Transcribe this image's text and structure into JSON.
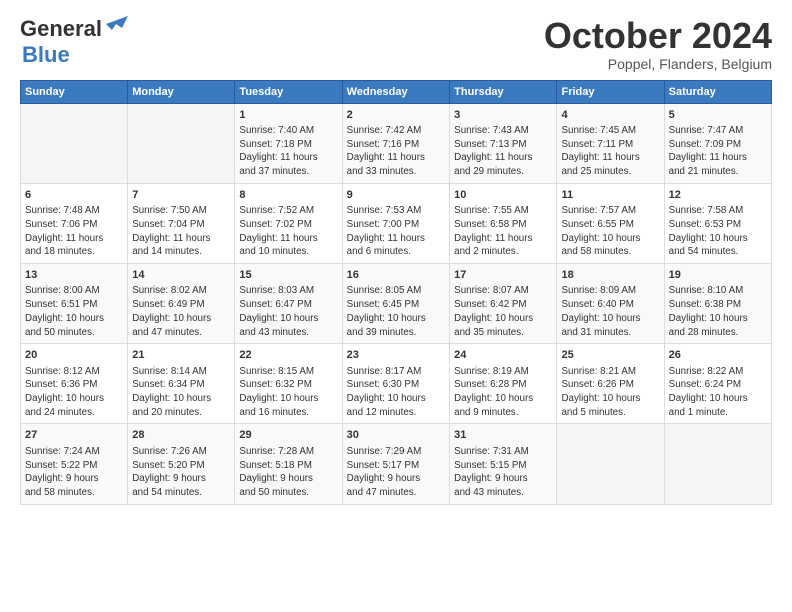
{
  "logo": {
    "line1": "General",
    "line2": "Blue"
  },
  "title": "October 2024",
  "location": "Poppel, Flanders, Belgium",
  "days_header": [
    "Sunday",
    "Monday",
    "Tuesday",
    "Wednesday",
    "Thursday",
    "Friday",
    "Saturday"
  ],
  "weeks": [
    [
      {
        "day": "",
        "info": ""
      },
      {
        "day": "",
        "info": ""
      },
      {
        "day": "1",
        "info": "Sunrise: 7:40 AM\nSunset: 7:18 PM\nDaylight: 11 hours\nand 37 minutes."
      },
      {
        "day": "2",
        "info": "Sunrise: 7:42 AM\nSunset: 7:16 PM\nDaylight: 11 hours\nand 33 minutes."
      },
      {
        "day": "3",
        "info": "Sunrise: 7:43 AM\nSunset: 7:13 PM\nDaylight: 11 hours\nand 29 minutes."
      },
      {
        "day": "4",
        "info": "Sunrise: 7:45 AM\nSunset: 7:11 PM\nDaylight: 11 hours\nand 25 minutes."
      },
      {
        "day": "5",
        "info": "Sunrise: 7:47 AM\nSunset: 7:09 PM\nDaylight: 11 hours\nand 21 minutes."
      }
    ],
    [
      {
        "day": "6",
        "info": "Sunrise: 7:48 AM\nSunset: 7:06 PM\nDaylight: 11 hours\nand 18 minutes."
      },
      {
        "day": "7",
        "info": "Sunrise: 7:50 AM\nSunset: 7:04 PM\nDaylight: 11 hours\nand 14 minutes."
      },
      {
        "day": "8",
        "info": "Sunrise: 7:52 AM\nSunset: 7:02 PM\nDaylight: 11 hours\nand 10 minutes."
      },
      {
        "day": "9",
        "info": "Sunrise: 7:53 AM\nSunset: 7:00 PM\nDaylight: 11 hours\nand 6 minutes."
      },
      {
        "day": "10",
        "info": "Sunrise: 7:55 AM\nSunset: 6:58 PM\nDaylight: 11 hours\nand 2 minutes."
      },
      {
        "day": "11",
        "info": "Sunrise: 7:57 AM\nSunset: 6:55 PM\nDaylight: 10 hours\nand 58 minutes."
      },
      {
        "day": "12",
        "info": "Sunrise: 7:58 AM\nSunset: 6:53 PM\nDaylight: 10 hours\nand 54 minutes."
      }
    ],
    [
      {
        "day": "13",
        "info": "Sunrise: 8:00 AM\nSunset: 6:51 PM\nDaylight: 10 hours\nand 50 minutes."
      },
      {
        "day": "14",
        "info": "Sunrise: 8:02 AM\nSunset: 6:49 PM\nDaylight: 10 hours\nand 47 minutes."
      },
      {
        "day": "15",
        "info": "Sunrise: 8:03 AM\nSunset: 6:47 PM\nDaylight: 10 hours\nand 43 minutes."
      },
      {
        "day": "16",
        "info": "Sunrise: 8:05 AM\nSunset: 6:45 PM\nDaylight: 10 hours\nand 39 minutes."
      },
      {
        "day": "17",
        "info": "Sunrise: 8:07 AM\nSunset: 6:42 PM\nDaylight: 10 hours\nand 35 minutes."
      },
      {
        "day": "18",
        "info": "Sunrise: 8:09 AM\nSunset: 6:40 PM\nDaylight: 10 hours\nand 31 minutes."
      },
      {
        "day": "19",
        "info": "Sunrise: 8:10 AM\nSunset: 6:38 PM\nDaylight: 10 hours\nand 28 minutes."
      }
    ],
    [
      {
        "day": "20",
        "info": "Sunrise: 8:12 AM\nSunset: 6:36 PM\nDaylight: 10 hours\nand 24 minutes."
      },
      {
        "day": "21",
        "info": "Sunrise: 8:14 AM\nSunset: 6:34 PM\nDaylight: 10 hours\nand 20 minutes."
      },
      {
        "day": "22",
        "info": "Sunrise: 8:15 AM\nSunset: 6:32 PM\nDaylight: 10 hours\nand 16 minutes."
      },
      {
        "day": "23",
        "info": "Sunrise: 8:17 AM\nSunset: 6:30 PM\nDaylight: 10 hours\nand 12 minutes."
      },
      {
        "day": "24",
        "info": "Sunrise: 8:19 AM\nSunset: 6:28 PM\nDaylight: 10 hours\nand 9 minutes."
      },
      {
        "day": "25",
        "info": "Sunrise: 8:21 AM\nSunset: 6:26 PM\nDaylight: 10 hours\nand 5 minutes."
      },
      {
        "day": "26",
        "info": "Sunrise: 8:22 AM\nSunset: 6:24 PM\nDaylight: 10 hours\nand 1 minute."
      }
    ],
    [
      {
        "day": "27",
        "info": "Sunrise: 7:24 AM\nSunset: 5:22 PM\nDaylight: 9 hours\nand 58 minutes."
      },
      {
        "day": "28",
        "info": "Sunrise: 7:26 AM\nSunset: 5:20 PM\nDaylight: 9 hours\nand 54 minutes."
      },
      {
        "day": "29",
        "info": "Sunrise: 7:28 AM\nSunset: 5:18 PM\nDaylight: 9 hours\nand 50 minutes."
      },
      {
        "day": "30",
        "info": "Sunrise: 7:29 AM\nSunset: 5:17 PM\nDaylight: 9 hours\nand 47 minutes."
      },
      {
        "day": "31",
        "info": "Sunrise: 7:31 AM\nSunset: 5:15 PM\nDaylight: 9 hours\nand 43 minutes."
      },
      {
        "day": "",
        "info": ""
      },
      {
        "day": "",
        "info": ""
      }
    ]
  ]
}
